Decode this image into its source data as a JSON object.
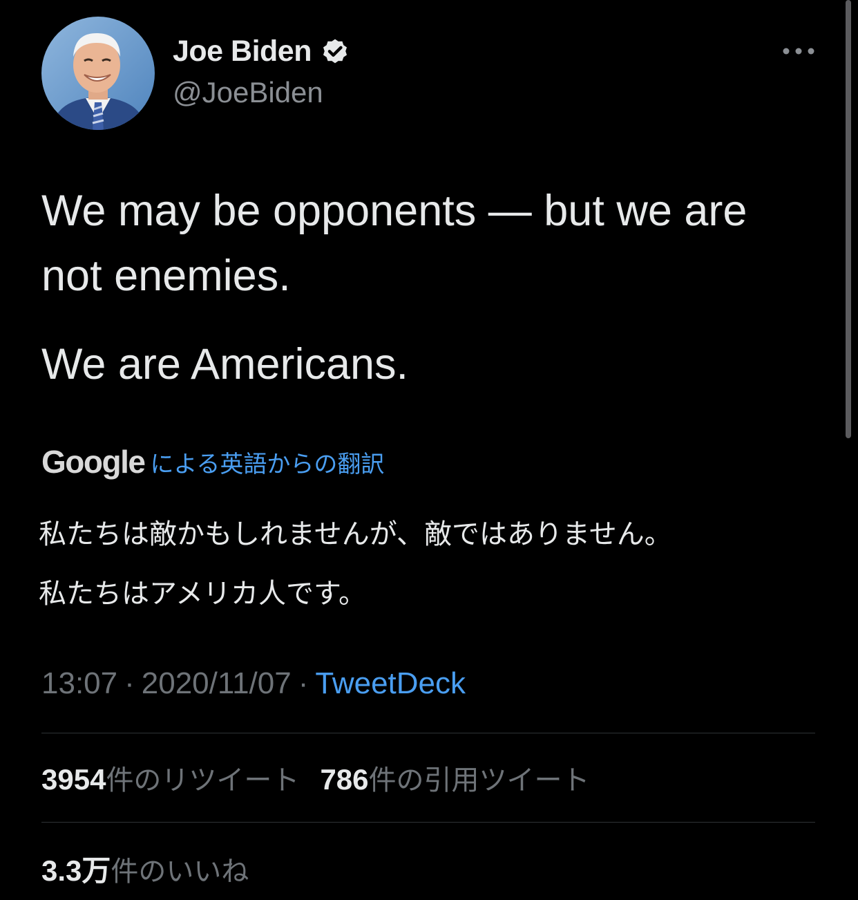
{
  "tweet": {
    "author": {
      "display_name": "Joe Biden",
      "handle": "@JoeBiden",
      "verified": true,
      "avatar": "profile-photo"
    },
    "text_paragraphs": [
      "We may be opponents — but we are not enemies.",
      "We are Americans."
    ],
    "translation": {
      "provider": "Google",
      "label": "による英語からの翻訳",
      "paragraphs": [
        "私たちは敵かもしれませんが、敵ではありません。",
        "私たちはアメリカ人です。"
      ]
    },
    "meta": {
      "time": "13:07",
      "separator": "·",
      "date": "2020/11/07",
      "source": "TweetDeck"
    },
    "stats": {
      "retweets_count": "3954",
      "retweets_label": "件のリツイート",
      "quotes_count": "786",
      "quotes_label": "件の引用ツイート",
      "likes_count": "3.3万",
      "likes_label": "件のいいね"
    }
  },
  "colors": {
    "background": "#000000",
    "text_primary": "#e7e9ea",
    "text_secondary": "#6e7378",
    "link": "#4a9ef1",
    "divider": "#2f3336"
  },
  "icons": {
    "verified": "verified-badge-icon",
    "more": "more-options-icon"
  }
}
